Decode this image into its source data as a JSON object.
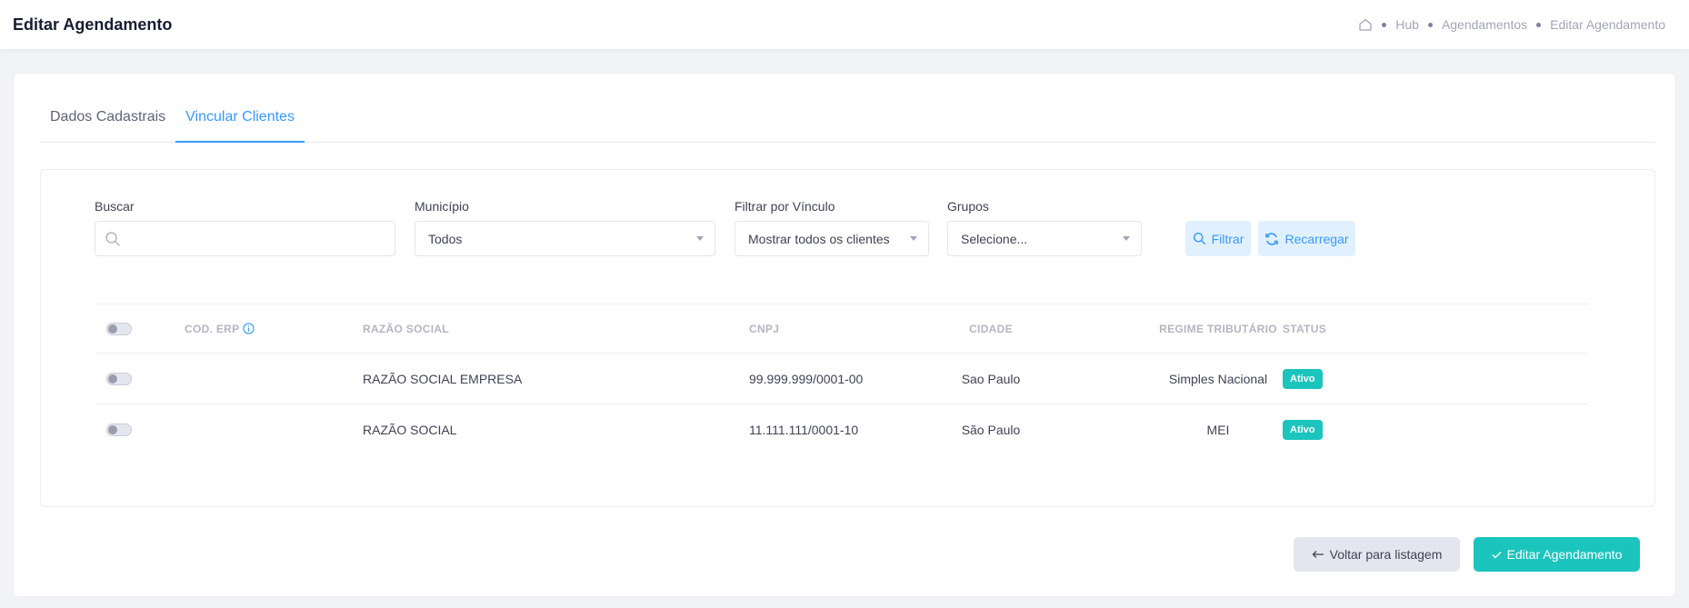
{
  "header": {
    "title": "Editar Agendamento",
    "breadcrumb": [
      "Hub",
      "Agendamentos",
      "Editar Agendamento"
    ]
  },
  "tabs": [
    {
      "label": "Dados Cadastrais",
      "active": false
    },
    {
      "label": "Vincular Clientes",
      "active": true
    }
  ],
  "filters": {
    "search": {
      "label": "Buscar",
      "value": "",
      "placeholder": ""
    },
    "municipio": {
      "label": "Município",
      "value": "Todos"
    },
    "vinculo": {
      "label": "Filtrar por Vínculo",
      "value": "Mostrar todos os clientes"
    },
    "grupos": {
      "label": "Grupos",
      "value": "Selecione..."
    },
    "filter_button": "Filtrar",
    "reload_button": "Recarregar"
  },
  "table": {
    "columns": [
      "COD. ERP",
      "RAZÃO SOCIAL",
      "CNPJ",
      "CIDADE",
      "REGIME TRIBUTÁRIO",
      "STATUS"
    ],
    "rows": [
      {
        "cod_erp": "",
        "razao_social": "RAZÃO SOCIAL EMPRESA",
        "cnpj": "99.999.999/0001-00",
        "cidade": "Sao Paulo",
        "regime": "Simples Nacional",
        "status": "Ativo",
        "selected": false
      },
      {
        "cod_erp": "",
        "razao_social": "RAZÃO SOCIAL",
        "cnpj": "11.111.111/0001-10",
        "cidade": "São Paulo",
        "regime": "MEI",
        "status": "Ativo",
        "selected": false
      }
    ]
  },
  "footer": {
    "back_label": "Voltar para listagem",
    "save_label": "Editar Agendamento"
  },
  "colors": {
    "primary": "#3699ff",
    "success": "#1bc5bd",
    "light_primary": "#e1f0ff"
  }
}
